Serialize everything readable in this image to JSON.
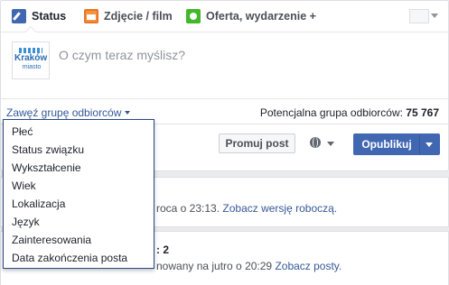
{
  "composer": {
    "tabs": [
      {
        "label": "Status",
        "icon": "pencil-icon"
      },
      {
        "label": "Zdjęcie / film",
        "icon": "photo-icon"
      },
      {
        "label": "Oferta, wydarzenie +",
        "icon": "event-icon"
      }
    ],
    "avatar": {
      "text": "Kraków",
      "sub": "miasto"
    },
    "placeholder": "O czym teraz myślisz?",
    "narrow_audience": "Zawęź grupę odbiorców",
    "potential_label": "Potencjalna grupa odbiorców:",
    "potential_value": "75 767",
    "promote_button": "Promuj post",
    "publish_button": "Opublikuj"
  },
  "audience_menu": {
    "items": [
      "Płeć",
      "Status związku",
      "Wykształcenie",
      "Wiek",
      "Lokalizacja",
      "Język",
      "Zainteresowania",
      "Data zakończenia posta"
    ]
  },
  "cards": {
    "draft_text": "roca o 23:13.",
    "draft_link": "Zobacz wersję roboczą.",
    "scheduled_title": ": 2",
    "scheduled_text": "nowany na jutro o 20:29",
    "scheduled_link": "Zobacz posty."
  },
  "colors": {
    "brand": "#4267b2",
    "link": "#365899",
    "photo": "#f7923a",
    "event": "#42b72a"
  }
}
